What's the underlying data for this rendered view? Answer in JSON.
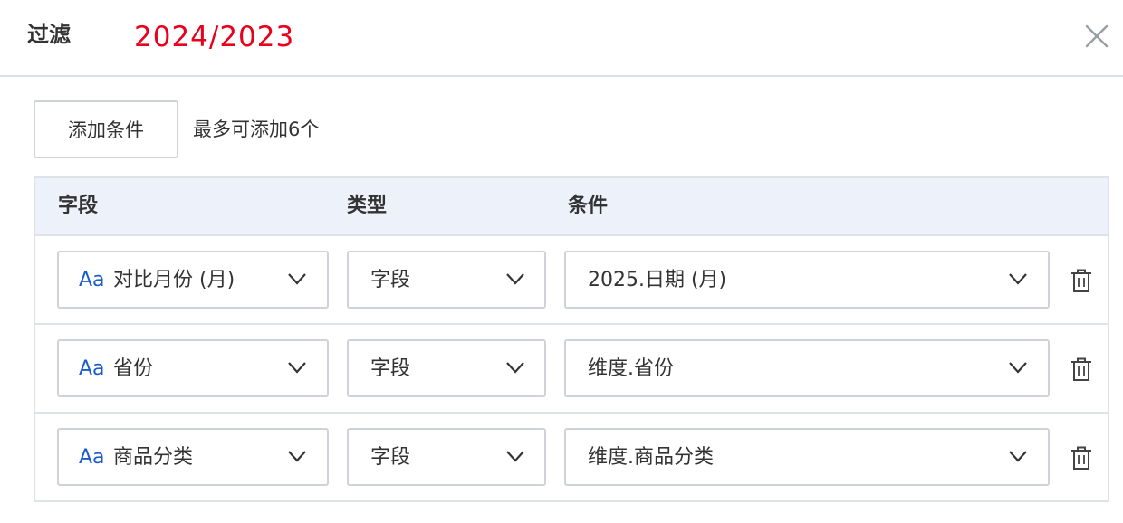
{
  "dialog": {
    "title": "过滤",
    "subtitle": "2024/2023",
    "close_icon": "close-icon"
  },
  "toolbar": {
    "add_label": "添加条件",
    "hint": "最多可添加6个"
  },
  "table": {
    "headers": {
      "field": "字段",
      "type": "类型",
      "condition": "条件"
    },
    "rows": [
      {
        "field_prefix": "Aa",
        "field": "对比月份 (月)",
        "type": "字段",
        "condition": "2025.日期 (月)"
      },
      {
        "field_prefix": "Aa",
        "field": "省份",
        "type": "字段",
        "condition": "维度.省份"
      },
      {
        "field_prefix": "Aa",
        "field": "商品分类",
        "type": "字段",
        "condition": "维度.商品分类"
      }
    ]
  },
  "colors": {
    "accent_red": "#e8001c",
    "field_icon_blue": "#1a5ccc",
    "header_bg": "#edf2fa"
  }
}
